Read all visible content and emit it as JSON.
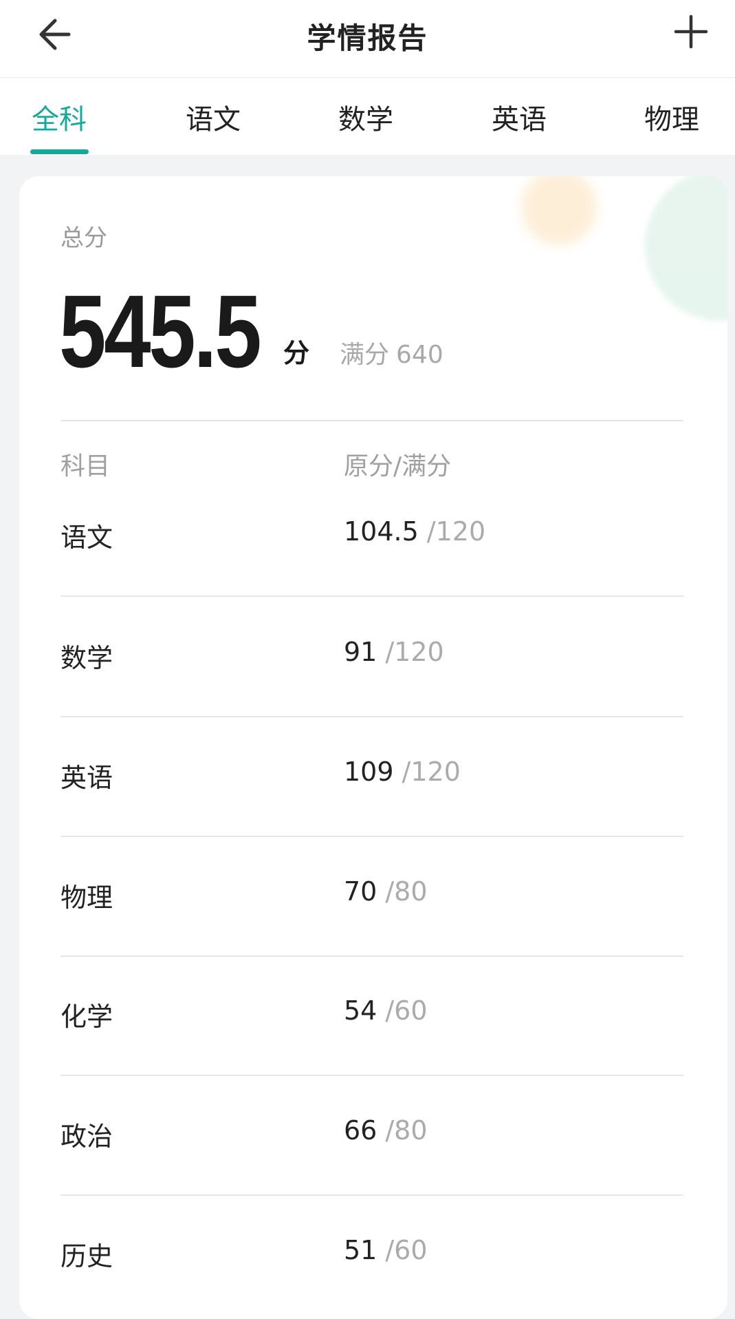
{
  "header": {
    "title": "学情报告"
  },
  "tabs": [
    {
      "label": "全科",
      "active": true
    },
    {
      "label": "语文",
      "active": false
    },
    {
      "label": "数学",
      "active": false
    },
    {
      "label": "英语",
      "active": false
    },
    {
      "label": "物理",
      "active": false
    }
  ],
  "summary": {
    "total_label": "总分",
    "total_score": "545.5",
    "total_unit": "分",
    "full_label": "满分",
    "full_score": "640"
  },
  "table": {
    "headers": {
      "subject": "科目",
      "score": "原分/满分"
    },
    "rows": [
      {
        "subject": "语文",
        "score": "104.5",
        "full": "/120"
      },
      {
        "subject": "数学",
        "score": "91",
        "full": "/120"
      },
      {
        "subject": "英语",
        "score": "109",
        "full": "/120"
      },
      {
        "subject": "物理",
        "score": "70",
        "full": "/80"
      },
      {
        "subject": "化学",
        "score": "54",
        "full": "/60"
      },
      {
        "subject": "政治",
        "score": "66",
        "full": "/80"
      },
      {
        "subject": "历史",
        "score": "51",
        "full": "/60"
      }
    ]
  },
  "colors": {
    "accent": "#14a99a",
    "text_primary": "#222222",
    "text_muted": "#a8a8a8",
    "background": "#f2f3f4"
  },
  "icons": {
    "back": "arrow-left-icon",
    "add": "plus-icon"
  }
}
